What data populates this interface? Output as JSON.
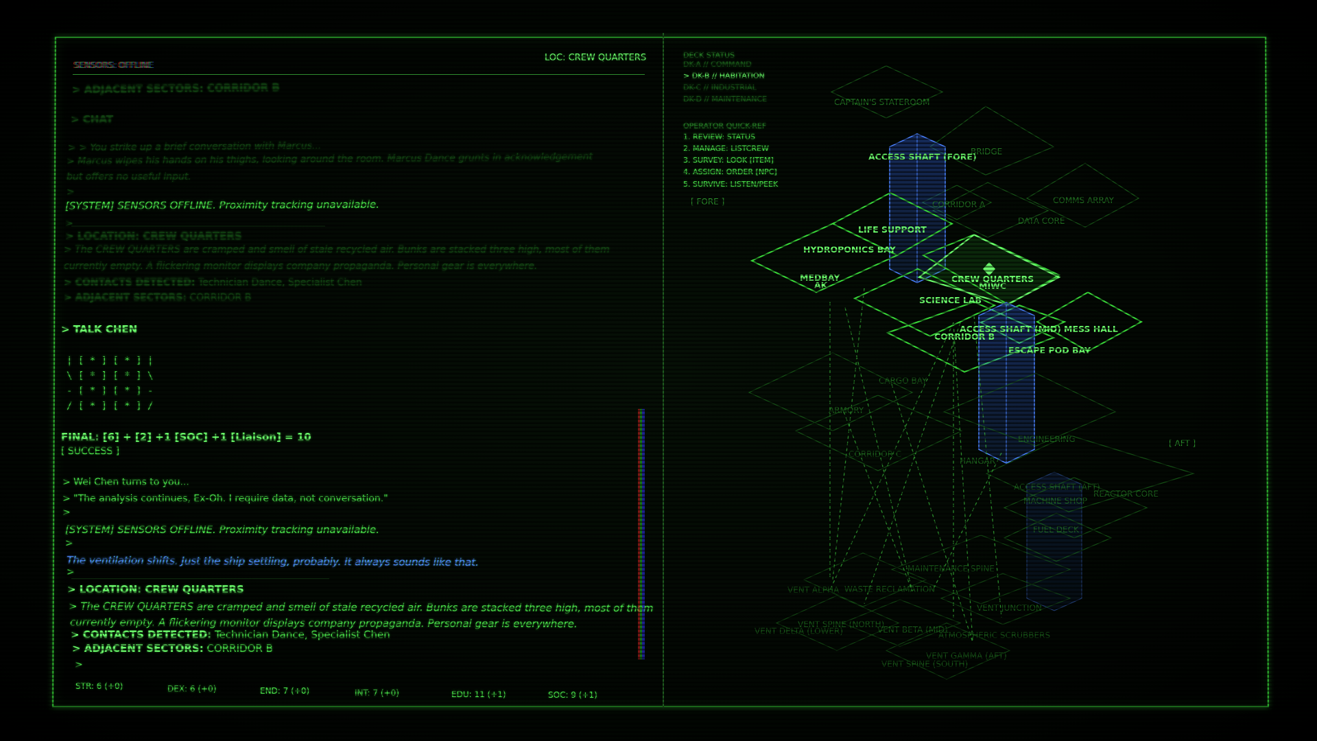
{
  "colors": {
    "phosphor": "#4be34b",
    "bright": "#6dff6d",
    "dim": "#258025",
    "accent_blue": "#4a82ff",
    "frame": "#2fb52f"
  },
  "header": {
    "sensors": "SENSORS: OFFLINE",
    "location": "LOC: CREW QUARTERS"
  },
  "log": {
    "l1": "> ADJACENT SECTORS: CORRIDOR B",
    "l2": "> CHAT",
    "l3": "> > You strike up a brief conversation with Marcus...",
    "l4": "> Marcus wipes his hands on his thighs, looking around the room. Marcus Dance grunts in acknowledgement",
    "l5": "but offers no useful input.",
    "l6": ">",
    "l7": "[SYSTEM] SENSORS OFFLINE. Proximity tracking unavailable.",
    "l8": ">",
    "l9": "> LOCATION: CREW QUARTERS",
    "l10": "> The CREW QUARTERS are cramped and smell of stale recycled air. Bunks are stacked three high, most of them",
    "l11": "currently empty. A flickering monitor displays company propaganda. Personal gear is everywhere.",
    "l12_label": "> CONTACTS DETECTED:",
    "l12_value": " Technician Dance, Specialist Chen",
    "l13_label": "> ADJACENT SECTORS:",
    "l13_value": " CORRIDOR B",
    "l14": "> TALK CHEN",
    "dice1": "| [ * ] [ * ] |",
    "dice2": "\\ [ * ] [ * ] \\",
    "dice3": "- [ * ] [ * ] -",
    "dice4": "/ [ * ] [ * ] /",
    "final": "FINAL: [6] + [2] +1 [SOC] +1 [Liaison] = 10",
    "success": "[ SUCCESS ]",
    "l15": "> Wei Chen turns to you...",
    "l16": "> \"The analysis continues, Ex-Oh. I require data, not conversation.\"",
    "l17": ">",
    "l18": "[SYSTEM] SENSORS OFFLINE. Proximity tracking unavailable.",
    "l19": ">",
    "l20": "The ventilation shifts. Just the ship settling, probably. It always sounds like that.",
    "l21": ">",
    "l22": "> LOCATION: CREW QUARTERS",
    "l23": "> The CREW QUARTERS are cramped and smell of stale recycled air. Bunks are stacked three high, most of them",
    "l24": "currently empty. A flickering monitor displays company propaganda. Personal gear is everywhere.",
    "l25_label": "> CONTACTS DETECTED:",
    "l25_value": " Technician Dance, Specialist Chen",
    "l26_label": "> ADJACENT SECTORS:",
    "l26_value": " CORRIDOR B",
    "prompt": ">"
  },
  "stats": {
    "str": "STR: 6 (+0)",
    "dex": "DEX: 6 (+0)",
    "end": "END: 7 (+0)",
    "int": "INT: 7 (+0)",
    "edu": "EDU: 11 (+1)",
    "soc": "SOC: 9 (+1)"
  },
  "deck_status": {
    "title": "DECK STATUS",
    "items": [
      "DK-A // COMMAND",
      "> DK-B // HABITATION",
      "DK-C // INDUSTRIAL",
      "DK-D // MAINTENANCE"
    ]
  },
  "quickref": {
    "title": "OPERATOR QUICK-REF",
    "items": [
      "1. REVIEW: STATUS",
      "2. MANAGE: LISTCREW",
      "3. SURVEY: LOOK [ITEM]",
      "4. ASSIGN: ORDER [NPC]",
      "5. SURVIVE: LISTEN/PEEK"
    ]
  },
  "map": {
    "fore": "[ FORE ]",
    "aft": "[ AFT ]",
    "labels_top": {
      "captains": "CAPTAIN'S STATEROOM",
      "bridge": "BRIDGE",
      "corridor_a": "CORRIDOR A",
      "comms": "COMMS ARRAY",
      "data_core": "DATA CORE"
    },
    "labels_main": {
      "access_fore": "ACCESS SHAFT (FORE)",
      "life_support": "LIFE SUPPORT",
      "hydroponics": "HYDROPONICS BAY",
      "medbay": "MEDBAY",
      "ak": "AK",
      "crew_quarters": "CREW QUARTERS",
      "miwc": "MIWC",
      "science_lab": "SCIENCE LAB",
      "access_mid": "ACCESS SHAFT (MID)",
      "mess_hall": "MESS HALL",
      "corridor_b": "CORRIDOR B",
      "escape_pod": "ESCAPE POD BAY"
    },
    "labels_lower": {
      "cargo_bay": "CARGO BAY",
      "armory": "ARMORY",
      "corridor_c": "CORRIDOR C",
      "engineering": "ENGINEERING",
      "hangar": "HANGAR",
      "access_aft": "ACCESS SHAFT (AFT)",
      "machine_shop": "MACHINE SHOP",
      "reactor": "REACTOR CORE",
      "fuel_deck": "FUEL DECK"
    },
    "labels_bottom": {
      "maintenance_spine": "MAINTENANCE SPINE",
      "vent_alpha": "VENT ALPHA",
      "waste": "WASTE RECLAMATION",
      "vent_junction": "VENT JUNCTION",
      "vent_delta": "VENT DELTA (LOWER)",
      "vent_spine_north": "VENT SPINE (NORTH)",
      "vent_beta": "VENT BETA (MID)",
      "scrubbers": "ATMOSPHERIC SCRUBBERS",
      "vent_gamma": "VENT GAMMA (AFT)",
      "vent_spine_south": "VENT SPINE (SOUTH)"
    }
  }
}
